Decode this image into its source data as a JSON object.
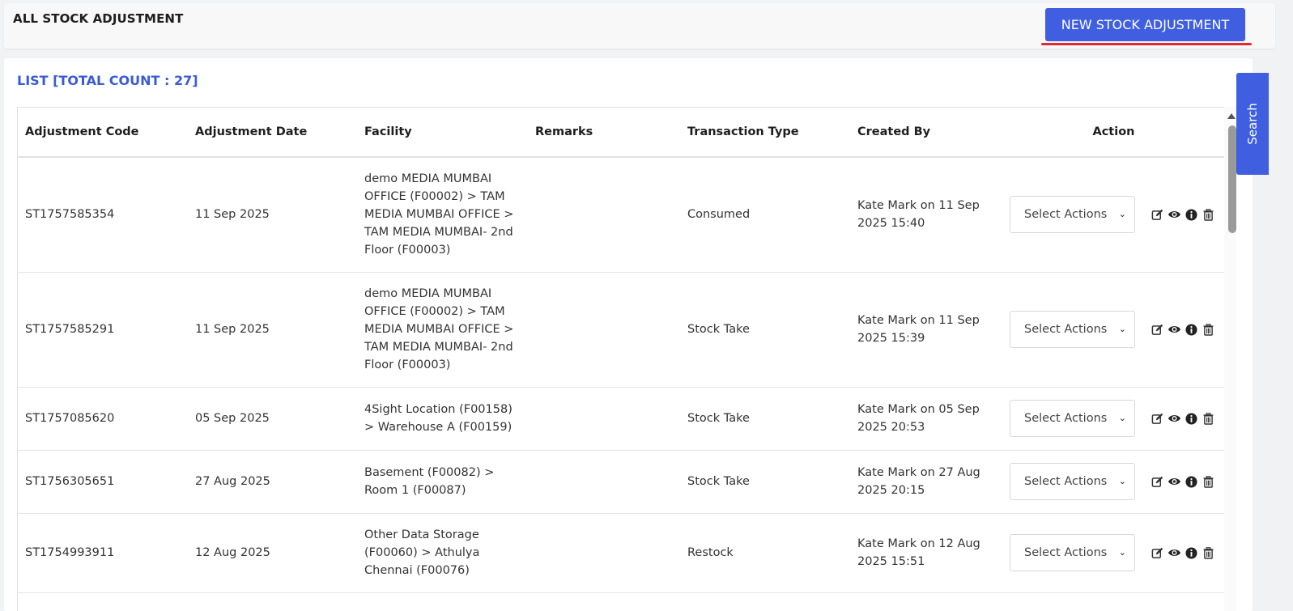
{
  "header": {
    "title": "ALL STOCK ADJUSTMENT",
    "new_button_label": "NEW STOCK ADJUSTMENT"
  },
  "list": {
    "title": "LIST [TOTAL COUNT : 27]"
  },
  "search_tab_label": "Search",
  "table": {
    "columns": {
      "code": "Adjustment Code",
      "date": "Adjustment Date",
      "facility": "Facility",
      "remarks": "Remarks",
      "type": "Transaction Type",
      "created": "Created By",
      "action": "Action"
    },
    "rows": [
      {
        "code": "ST1757585354",
        "date": "11 Sep 2025",
        "facility": "demo MEDIA MUMBAI OFFICE (F00002) > TAM MEDIA MUMBAI OFFICE > TAM MEDIA MUMBAI- 2nd Floor (F00003)",
        "remarks": "",
        "type": "Consumed",
        "created": "Kate Mark on 11 Sep 2025 15:40",
        "select": "Select Actions"
      },
      {
        "code": "ST1757585291",
        "date": "11 Sep 2025",
        "facility": "demo MEDIA MUMBAI OFFICE (F00002) > TAM MEDIA MUMBAI OFFICE > TAM MEDIA MUMBAI- 2nd Floor (F00003)",
        "remarks": "",
        "type": "Stock Take",
        "created": "Kate Mark on 11 Sep 2025 15:39",
        "select": "Select Actions"
      },
      {
        "code": "ST1757085620",
        "date": "05 Sep 2025",
        "facility": "4Sight Location (F00158) > Warehouse A (F00159)",
        "remarks": "",
        "type": "Stock Take",
        "created": "Kate Mark on 05 Sep 2025 20:53",
        "select": "Select Actions"
      },
      {
        "code": "ST1756305651",
        "date": "27 Aug 2025",
        "facility": "Basement (F00082) > Room 1 (F00087)",
        "remarks": "",
        "type": "Stock Take",
        "created": "Kate Mark on 27 Aug 2025 20:15",
        "select": "Select Actions"
      },
      {
        "code": "ST1754993911",
        "date": "12 Aug 2025",
        "facility": "Other Data Storage (F00060) > Athulya Chennai (F00076)",
        "remarks": "",
        "type": "Restock",
        "created": "Kate Mark on 12 Aug 2025 15:51",
        "select": "Select Actions"
      }
    ]
  },
  "colors": {
    "accent": "#3f5fe0",
    "list_title": "#3a5bd6",
    "underline": "#e8262f"
  }
}
